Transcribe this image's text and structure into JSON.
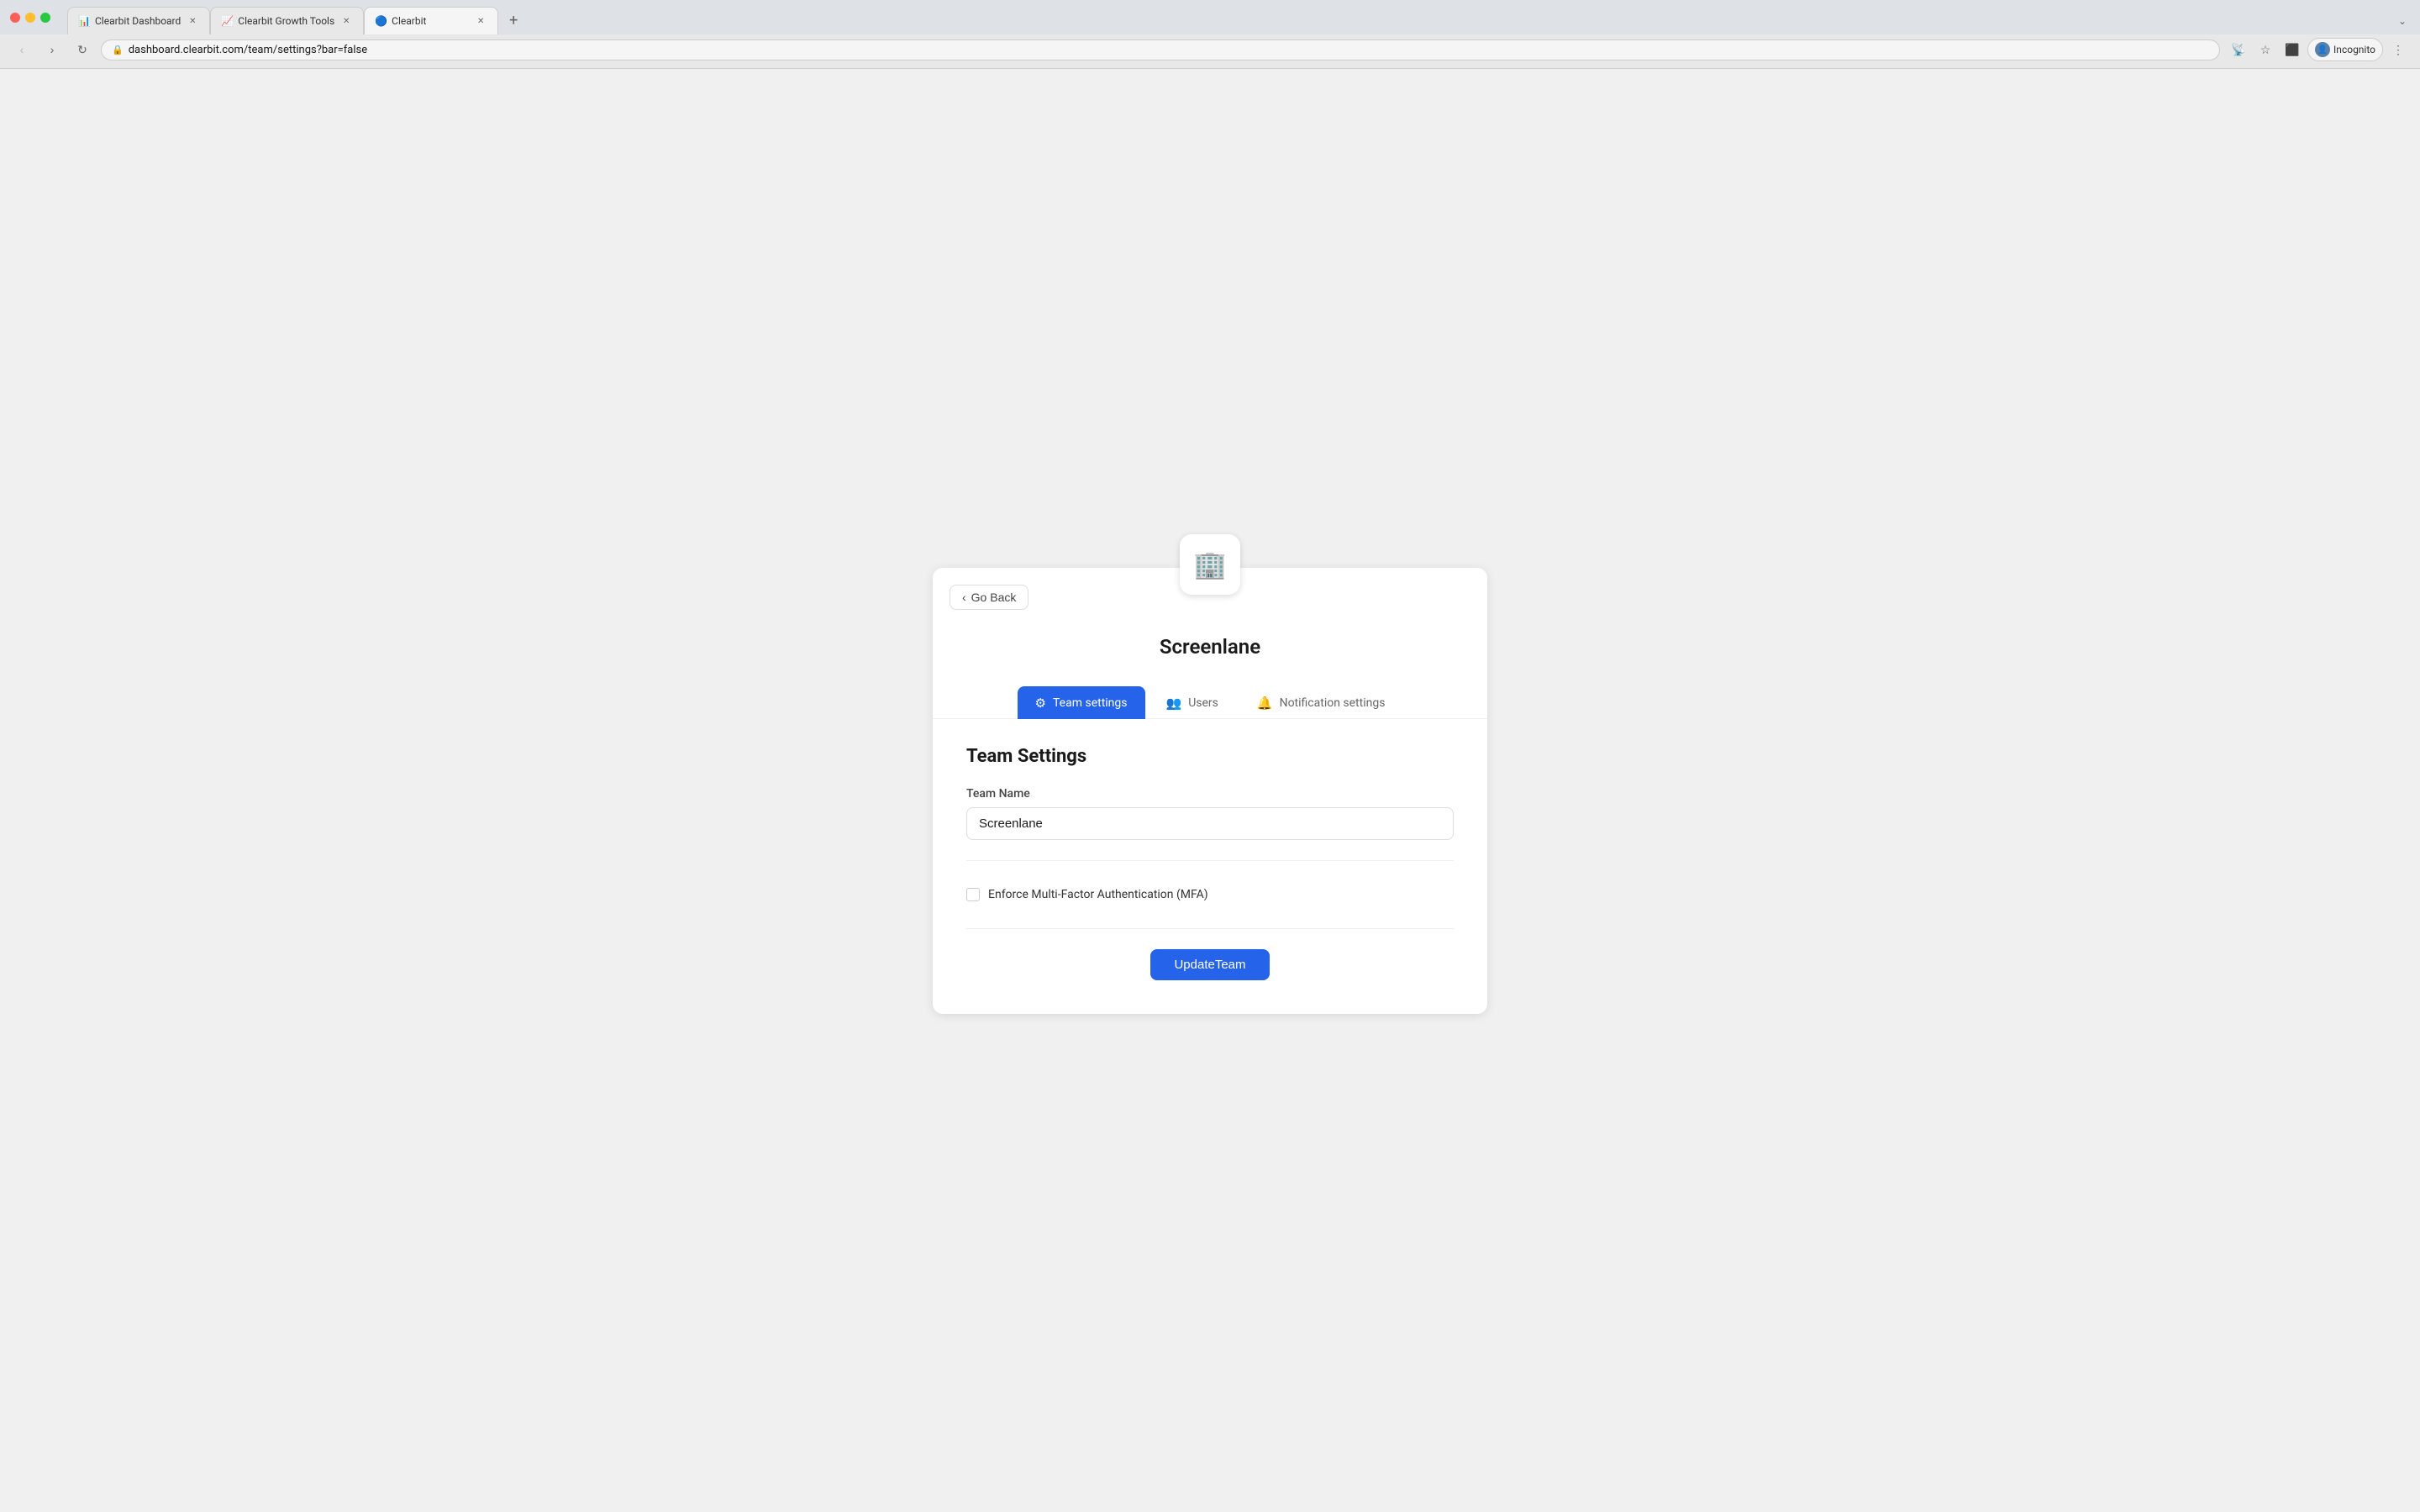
{
  "browser": {
    "tabs": [
      {
        "id": "tab1",
        "label": "Clearbit Dashboard",
        "active": false,
        "favicon": "📊"
      },
      {
        "id": "tab2",
        "label": "Clearbit Growth Tools",
        "active": false,
        "favicon": "📈"
      },
      {
        "id": "tab3",
        "label": "Clearbit",
        "active": true,
        "favicon": "🔵"
      }
    ],
    "url": "dashboard.clearbit.com/team/settings?bar=false",
    "profile_label": "Incognito"
  },
  "card": {
    "company_name": "Screenlane",
    "go_back_label": "Go Back",
    "tabs": [
      {
        "id": "team-settings",
        "label": "Team settings",
        "active": true,
        "icon": "⚙"
      },
      {
        "id": "users",
        "label": "Users",
        "active": false,
        "icon": "👥"
      },
      {
        "id": "notification-settings",
        "label": "Notification settings",
        "active": false,
        "icon": "🔔"
      }
    ],
    "section_title": "Team Settings",
    "form": {
      "team_name_label": "Team Name",
      "team_name_value": "Screenlane",
      "team_name_placeholder": "Team Name",
      "mfa_label": "Enforce Multi-Factor Authentication (MFA)",
      "mfa_checked": false,
      "update_button_label": "UpdateTeam"
    }
  }
}
